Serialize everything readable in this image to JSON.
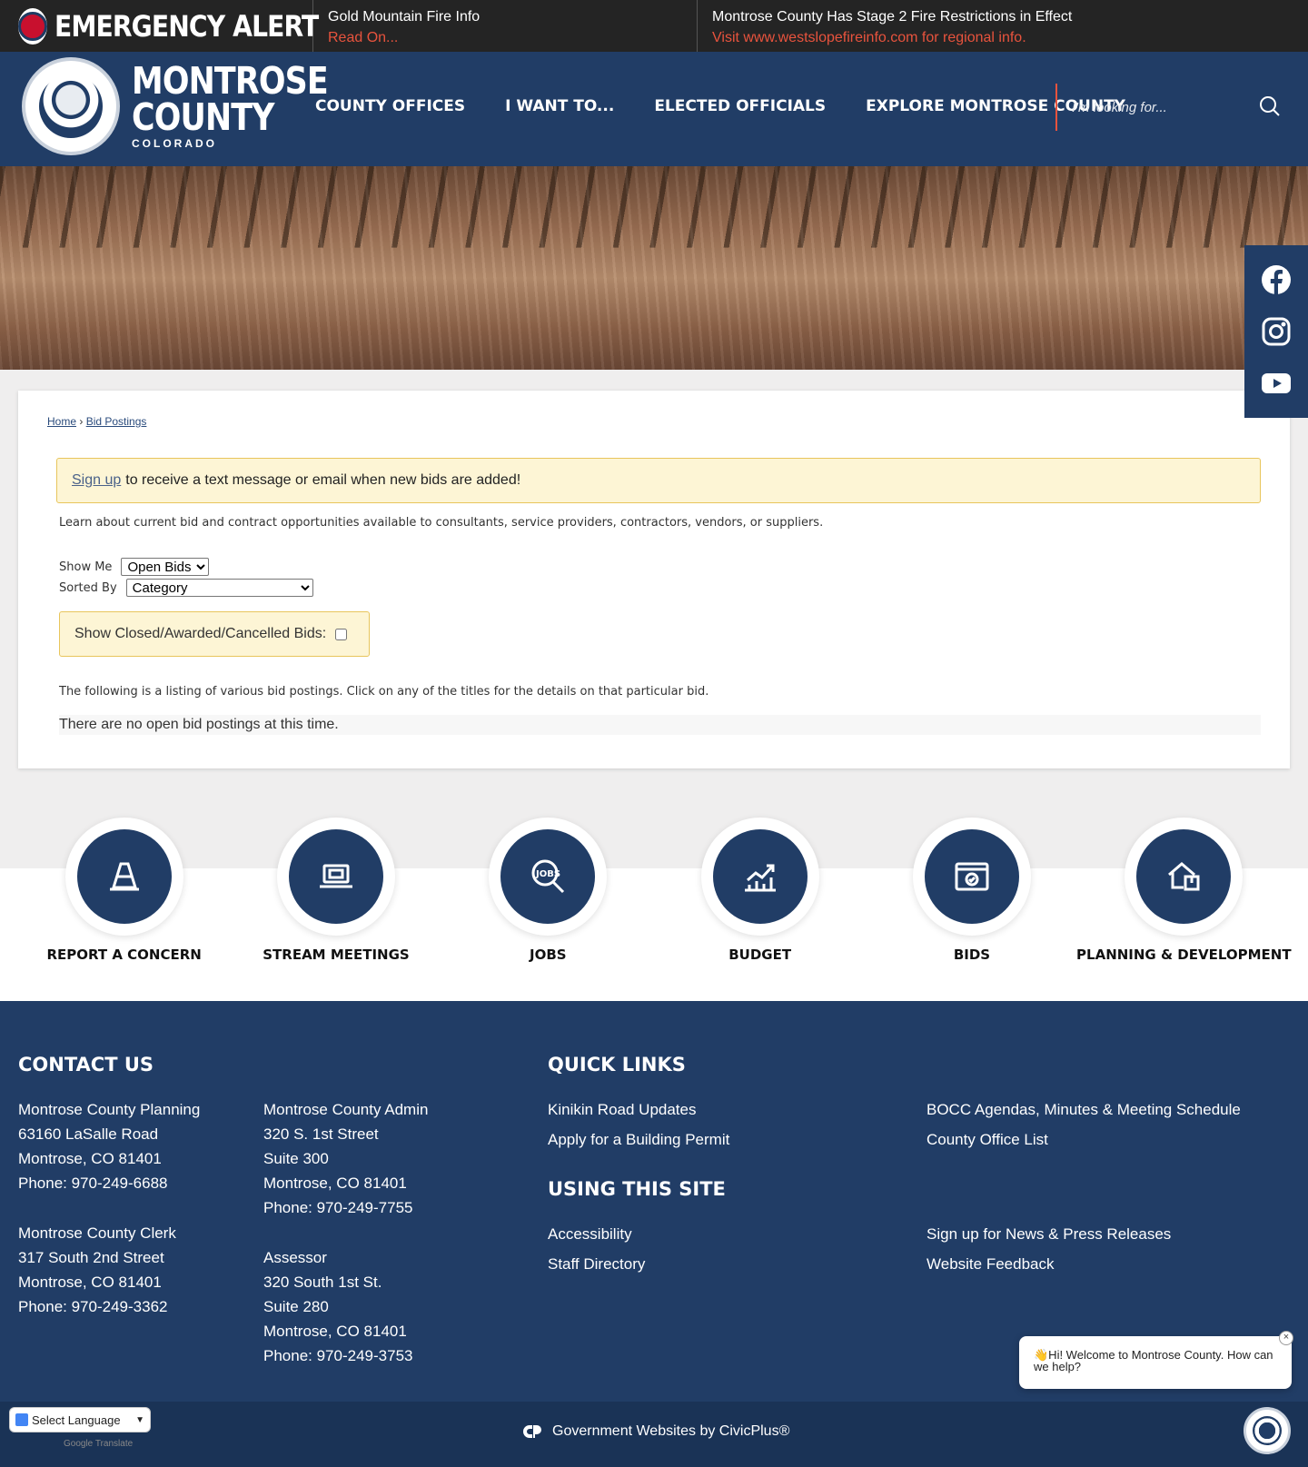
{
  "alert": {
    "title": "EMERGENCY ALERT",
    "items": [
      {
        "title": "Gold Mountain Fire Info",
        "link": "Read On..."
      },
      {
        "title": "Montrose County Has Stage 2 Fire Restrictions in Effect",
        "link": "Visit www.westslopefireinfo.com for regional info."
      }
    ]
  },
  "header": {
    "logo_line1": "MONTROSE",
    "logo_line2": "COUNTY",
    "logo_line3": "COLORADO",
    "nav": [
      "COUNTY OFFICES",
      "I WANT TO...",
      "ELECTED OFFICIALS",
      "EXPLORE MONTROSE COUNTY"
    ],
    "search_placeholder": "I'm looking for..."
  },
  "social": [
    "facebook-icon",
    "instagram-icon",
    "youtube-icon"
  ],
  "breadcrumb": {
    "home": "Home",
    "sep": "›",
    "current": "Bid Postings"
  },
  "notice": {
    "link": "Sign up",
    "text": "to receive a text message or email when new bids are added!"
  },
  "intro": "Learn about current bid and contract opportunities available to consultants, service providers, contractors, vendors, or suppliers.",
  "filters": {
    "show_me_label": "Show Me",
    "show_me_value": "Open Bids",
    "sorted_by_label": "Sorted By",
    "sorted_by_value": "Category",
    "closed_label": "Show Closed/Awarded/Cancelled Bids:"
  },
  "listing_note": "The following is a listing of various bid postings. Click on any of the titles for the details on that particular bid.",
  "no_bids": "There are no open bid postings at this time.",
  "tiles": [
    {
      "label": "REPORT A CONCERN",
      "icon": "cone-icon"
    },
    {
      "label": "STREAM MEETINGS",
      "icon": "laptop-icon"
    },
    {
      "label": "JOBS",
      "icon": "jobs-search-icon"
    },
    {
      "label": "BUDGET",
      "icon": "chart-growth-icon"
    },
    {
      "label": "BIDS",
      "icon": "browser-check-icon"
    },
    {
      "label": "PLANNING & DEVELOPMENT",
      "icon": "house-plan-icon"
    }
  ],
  "footer": {
    "contact_title": "CONTACT US",
    "contacts": [
      {
        "lines": [
          "Montrose County Planning",
          "63160 LaSalle Road",
          "Montrose, CO 81401",
          "Phone: 970-249-6688"
        ]
      },
      {
        "lines": [
          "Montrose County Admin",
          "320 S. 1st Street",
          "Suite 300",
          "Montrose, CO 81401",
          "Phone: 970-249-7755"
        ]
      },
      {
        "lines": [
          "Montrose County Clerk",
          "317 South 2nd Street",
          "Montrose, CO 81401",
          "Phone: 970-249-3362"
        ]
      },
      {
        "lines": [
          "Assessor",
          "320 South 1st St.",
          "Suite 280",
          "Montrose, CO 81401",
          "Phone: 970-249-3753"
        ]
      }
    ],
    "quick_links_title": "QUICK LINKS",
    "quick_links": [
      "Kinikin Road Updates",
      "Apply for a Building Permit",
      "BOCC Agendas, Minutes & Meeting Schedule",
      "County Office List"
    ],
    "using_site_title": "USING THIS SITE",
    "using_site": [
      "Accessibility",
      "Staff Directory",
      "Sign up for News & Press Releases",
      "Website Feedback"
    ],
    "civicplus": "Government Websites by CivicPlus®"
  },
  "translate": {
    "select": "Select Language",
    "powered": "Google Translate"
  },
  "chat": {
    "message": "👋Hi! Welcome to Montrose County. How can we help?",
    "close": "×"
  },
  "colors": {
    "navy": "#213d66",
    "alert_link": "#e8533d",
    "notice_bg": "#fdf5d5"
  }
}
